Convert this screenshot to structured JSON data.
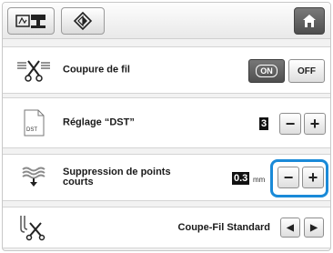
{
  "toolbar": {
    "embroidery_icon": "embroidery-machine-icon",
    "pattern_icon": "pattern-diamond-icon",
    "home_icon": "home-icon"
  },
  "settings": {
    "thread_cut": {
      "label": "Coupure de fil",
      "on_label": "ON",
      "off_label": "OFF",
      "icon": "thread-cut-scissors-icon"
    },
    "dst": {
      "label": "Réglage “DST”",
      "value": "3",
      "minus": "−",
      "plus": "+",
      "icon_text": "DST"
    },
    "short_stitch": {
      "label_line1": "Suppression de points",
      "label_line2": "courts",
      "value": "0.3",
      "unit": "mm",
      "minus": "−",
      "plus": "+",
      "icon": "short-stitch-icon"
    },
    "cutter": {
      "label": "Coupe-Fil Standard",
      "left": "◀",
      "right": "▶",
      "icon": "thread-cutter-icon"
    }
  },
  "colors": {
    "highlight": "#1a8ad8",
    "on_button": "#5a5a5a"
  }
}
